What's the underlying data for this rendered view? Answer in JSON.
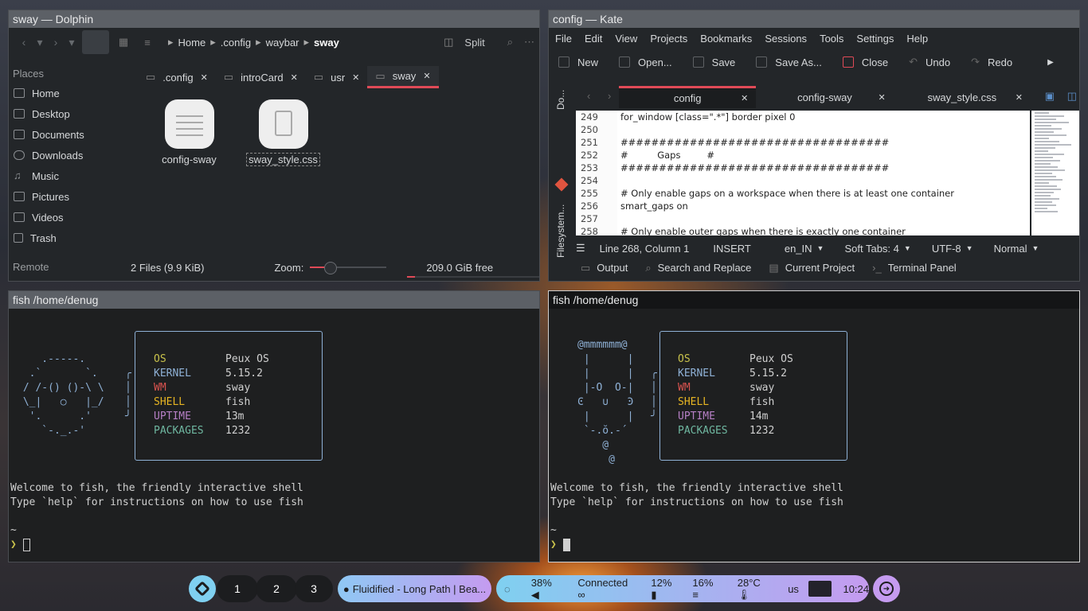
{
  "dolphin": {
    "title": "sway — Dolphin",
    "split_label": "Split",
    "breadcrumbs": [
      "Home",
      ".config",
      "waybar",
      "sway"
    ],
    "places_header": "Places",
    "places": [
      "Home",
      "Desktop",
      "Documents",
      "Downloads",
      "Music",
      "Pictures",
      "Videos",
      "Trash"
    ],
    "remote_header": "Remote",
    "tabs": [
      ".config",
      "introCard",
      "usr",
      "sway"
    ],
    "files": [
      "config-sway",
      "sway_style.css"
    ],
    "status": "2 Files (9.9 KiB)",
    "zoom_label": "Zoom:",
    "free_space": "209.0 GiB free"
  },
  "kate": {
    "title": "config — Kate",
    "menu": [
      "File",
      "Edit",
      "View",
      "Projects",
      "Bookmarks",
      "Sessions",
      "Tools",
      "Settings",
      "Help"
    ],
    "toolbar": [
      "New",
      "Open...",
      "Save",
      "Save As...",
      "Close",
      "Undo",
      "Redo"
    ],
    "tabs": [
      "config",
      "config-sway",
      "sway_style.css"
    ],
    "side_tabs": [
      "Do...",
      "Filesystem..."
    ],
    "lines": [
      {
        "n": "249",
        "t": "for_window [class=\".*\"] border pixel 0"
      },
      {
        "n": "250",
        "t": ""
      },
      {
        "n": "251",
        "t": "###################################"
      },
      {
        "n": "252",
        "t": "#          Gaps         #"
      },
      {
        "n": "253",
        "t": "###################################"
      },
      {
        "n": "254",
        "t": ""
      },
      {
        "n": "255",
        "t": "# Only enable gaps on a workspace when there is at least one container"
      },
      {
        "n": "256",
        "t": "smart_gaps on"
      },
      {
        "n": "257",
        "t": ""
      },
      {
        "n": "258",
        "t": "# Only enable outer gaps when there is exactly one container"
      }
    ],
    "status": {
      "position": "Line 268, Column 1",
      "mode": "INSERT",
      "lang": "en_IN",
      "tabs": "Soft Tabs: 4",
      "encoding": "UTF-8",
      "input": "Normal"
    },
    "panels": [
      "Output",
      "Search and Replace",
      "Current Project",
      "Terminal Panel"
    ]
  },
  "term_left": {
    "title": "fish /home/denug",
    "labels": [
      "OS",
      "KERNEL",
      "WM",
      "SHELL",
      "UPTIME",
      "PACKAGES"
    ],
    "values": [
      "Peux OS",
      "5.15.2",
      "sway",
      "fish",
      "13m",
      "1232"
    ],
    "welcome": "Welcome to fish, the friendly interactive shell",
    "help": "Type `help` for instructions on how to use fish",
    "cwd": "~",
    "prompt": "❯"
  },
  "term_right": {
    "title": "fish /home/denug",
    "labels": [
      "OS",
      "KERNEL",
      "WM",
      "SHELL",
      "UPTIME",
      "PACKAGES"
    ],
    "values": [
      "Peux OS",
      "5.15.2",
      "sway",
      "fish",
      "14m",
      "1232"
    ],
    "welcome": "Welcome to fish, the friendly interactive shell",
    "help": "Type `help` for instructions on how to use fish",
    "cwd": "~",
    "prompt": "❯"
  },
  "bar": {
    "workspaces": [
      "1",
      "2",
      "3"
    ],
    "media": "Fluidified - Long Path | Bea...",
    "volume": "38%",
    "network": "Connected",
    "battery": "12%",
    "memory": "16%",
    "temp": "28°C",
    "layout": "us",
    "clock": "10:24"
  },
  "colors": {
    "accent": "#e04a57",
    "os": "#c9c24b",
    "kernel": "#8fb1d6",
    "wm": "#d9534f",
    "shell": "#e6b422",
    "uptime": "#b67fc5",
    "packages": "#6fb7a0",
    "bar_left": "#7fd0f0",
    "bar_right": "#c59bf0"
  }
}
